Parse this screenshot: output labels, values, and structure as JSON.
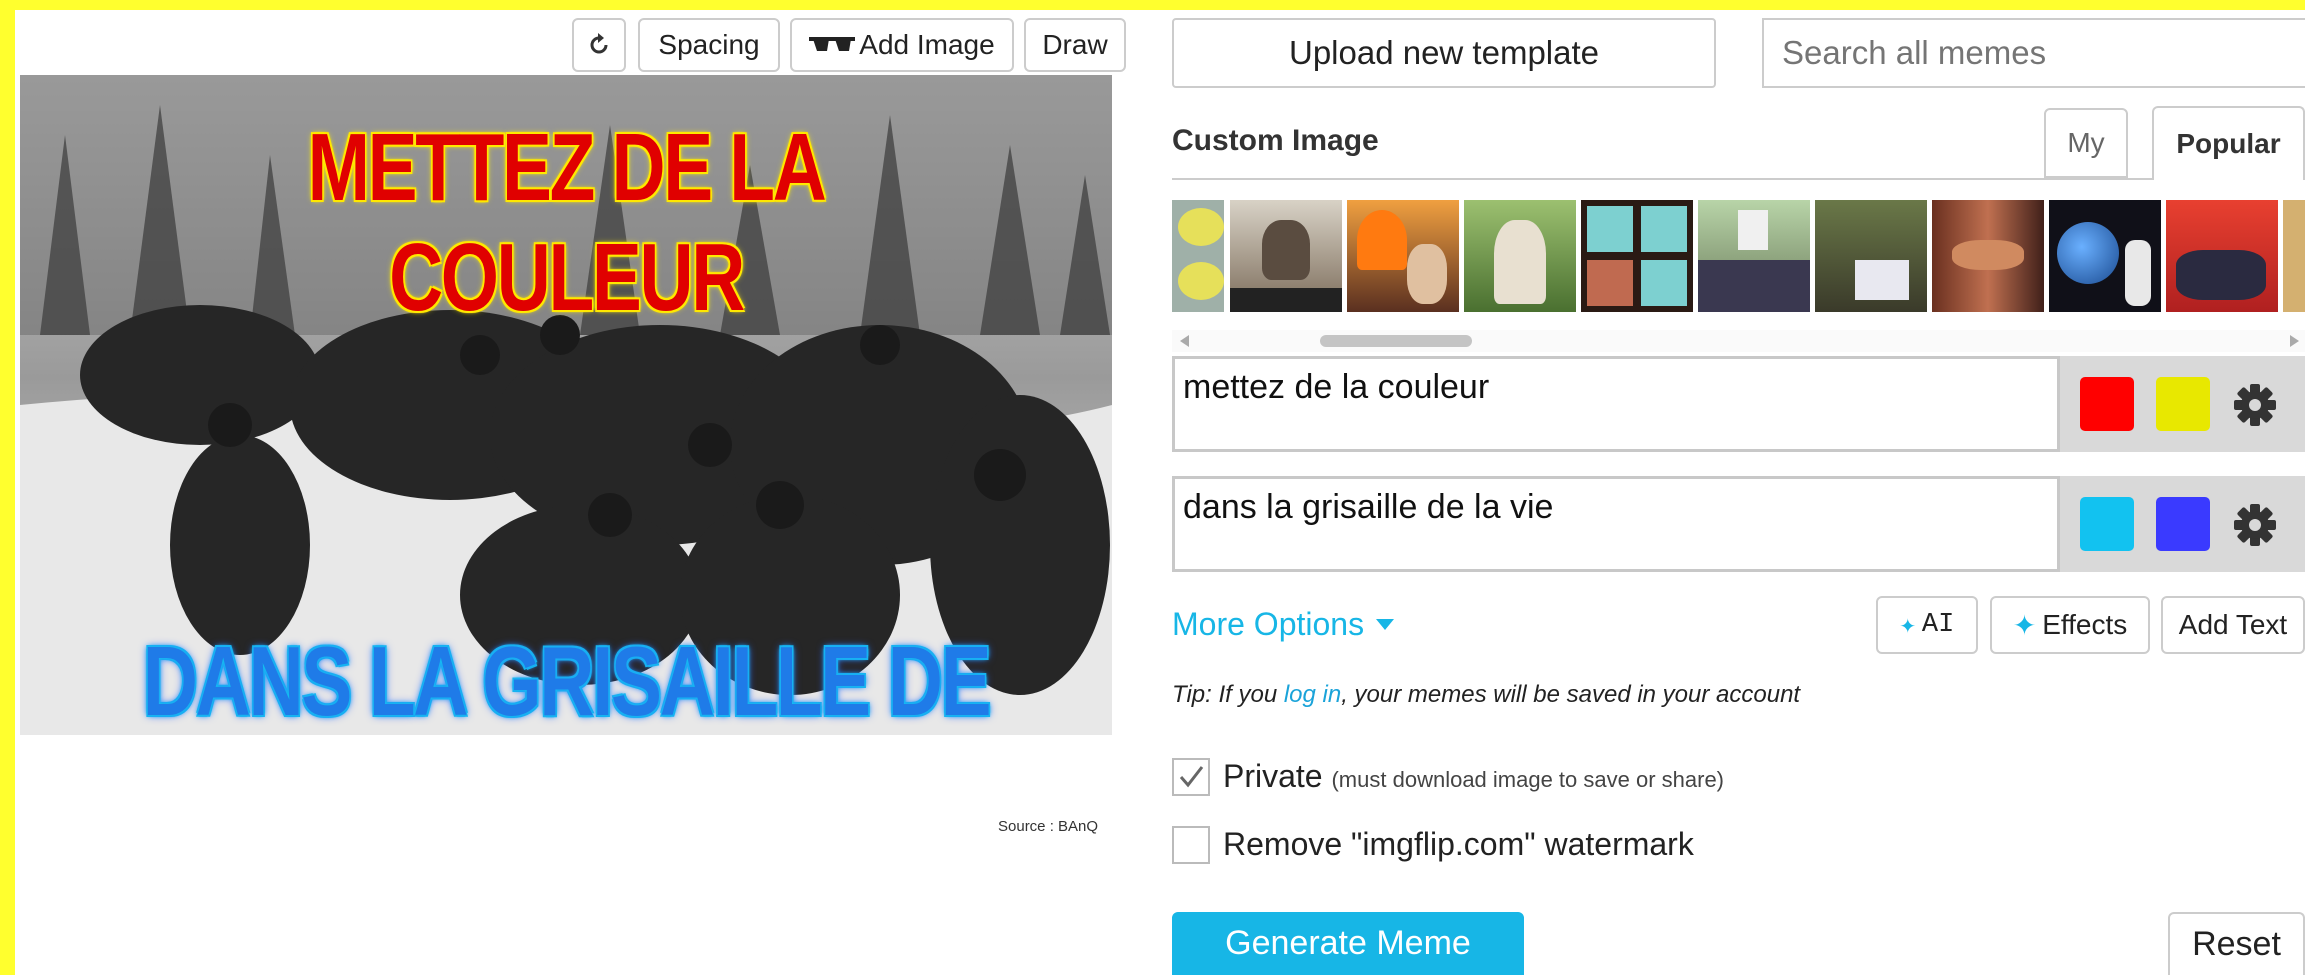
{
  "toolbar": {
    "rotate_icon": "refresh-icon",
    "spacing_label": "Spacing",
    "add_image_label": "Add Image",
    "draw_label": "Draw"
  },
  "meme": {
    "top_caption": "METTEZ DE LA COULEUR",
    "bottom_caption": "DANS LA GRISAILLE DE LA VIE",
    "source_credit": "Source : BAnQ"
  },
  "header": {
    "upload_label": "Upload new template",
    "search_placeholder": "Search all memes"
  },
  "templates": {
    "title": "Custom Image",
    "tab_my": "My",
    "tab_popular": "Popular"
  },
  "text_boxes": [
    {
      "value": "mettez de la couleur",
      "color_1": "#ff0000",
      "color_2": "#e8e800"
    },
    {
      "value": "dans la grisaille de la vie",
      "color_1": "#12c2f0",
      "color_2": "#3a3aff"
    }
  ],
  "options": {
    "more_options_label": "More Options",
    "ai_label": "AI",
    "effects_label": "Effects",
    "add_text_label": "Add Text"
  },
  "tip": {
    "prefix": "Tip: If you ",
    "link": "log in",
    "suffix": ", your memes will be saved in your account"
  },
  "checkboxes": {
    "private_label": "Private",
    "private_note": "(must download image to save or share)",
    "private_checked": true,
    "watermark_label": "Remove \"imgflip.com\" watermark",
    "watermark_checked": false
  },
  "actions": {
    "generate_label": "Generate Meme",
    "reset_label": "Reset"
  },
  "colors": {
    "accent": "#17b6e6",
    "link": "#1aa3d9",
    "page_border": "#ffff2e"
  }
}
